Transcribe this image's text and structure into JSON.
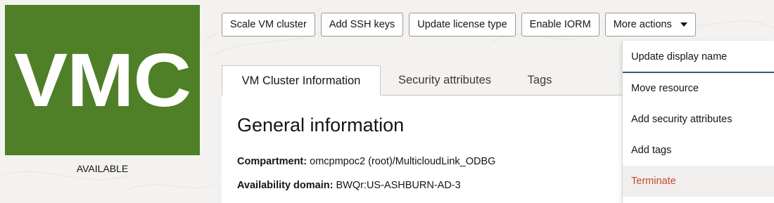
{
  "resource": {
    "abbreviation": "VMC",
    "status": "AVAILABLE",
    "tile_color": "#4f7f26"
  },
  "actions": {
    "scale": "Scale VM cluster",
    "add_ssh": "Add SSH keys",
    "update_license": "Update license type",
    "enable_iorm": "Enable IORM",
    "more_actions": "More actions"
  },
  "tabs": [
    {
      "label": "VM Cluster Information",
      "active": true
    },
    {
      "label": "Security attributes",
      "active": false
    },
    {
      "label": "Tags",
      "active": false
    }
  ],
  "general_info": {
    "title": "General information",
    "fields": [
      {
        "label": "Compartment:",
        "value": "omcpmpoc2 (root)/MulticloudLink_ODBG"
      },
      {
        "label": "Availability domain:",
        "value": "BWQr:US-ASHBURN-AD-3"
      }
    ]
  },
  "menu": {
    "items": [
      {
        "label": "Update display name"
      },
      {
        "label": "Move resource"
      },
      {
        "label": "Add security attributes"
      },
      {
        "label": "Add tags"
      },
      {
        "label": "Terminate",
        "danger_color": "#c74634"
      }
    ]
  },
  "icons": {
    "dropdown": "caret-down-icon"
  }
}
